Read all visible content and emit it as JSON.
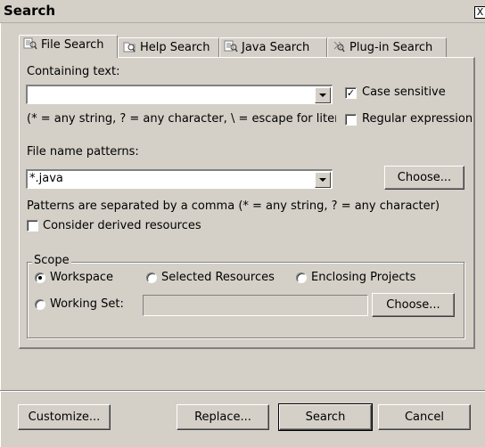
{
  "window": {
    "title": "Search",
    "close_glyph": "X"
  },
  "tabs": [
    {
      "label": "File Search",
      "icon": "file-search-icon",
      "active": true
    },
    {
      "label": "Help Search",
      "icon": "help-search-icon",
      "active": false
    },
    {
      "label": "Java Search",
      "icon": "java-search-icon",
      "active": false
    },
    {
      "label": "Plug-in Search",
      "icon": "plugin-search-icon",
      "active": false
    }
  ],
  "containing_text": {
    "label": "Containing text:",
    "value": "",
    "hint": "(* = any string, ? = any character, \\ = escape for litera",
    "case_sensitive": {
      "label": "Case sensitive",
      "checked": true
    },
    "regular_expression": {
      "label": "Regular expression",
      "checked": false
    }
  },
  "file_name_patterns": {
    "label": "File name patterns:",
    "value": "*.java",
    "choose_label": "Choose...",
    "hint": "Patterns are separated by a comma (* = any string, ? = any character)",
    "derived": {
      "label": "Consider derived resources",
      "checked": false
    }
  },
  "scope": {
    "title": "Scope",
    "workspace": {
      "label": "Workspace",
      "selected": true
    },
    "selected_resources": {
      "label": "Selected Resources",
      "selected": false
    },
    "enclosing_projects": {
      "label": "Enclosing Projects",
      "selected": false
    },
    "working_set": {
      "label": "Working Set:",
      "selected": false,
      "value": ""
    },
    "choose_label": "Choose..."
  },
  "buttons": {
    "customize": "Customize...",
    "replace": "Replace...",
    "search": "Search",
    "cancel": "Cancel"
  },
  "colors": {
    "face": "#d4d0c8",
    "shadow": "#808080",
    "highlight": "#ffffff"
  }
}
